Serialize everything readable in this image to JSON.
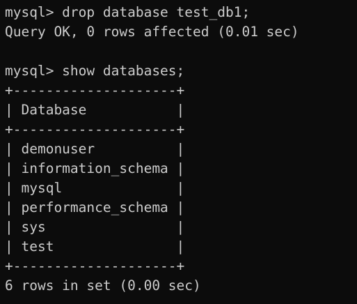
{
  "terminal": {
    "lines": [
      "mysql> drop database test_db1;",
      "Query OK, 0 rows affected (0.01 sec)",
      "",
      "mysql> show databases;",
      "+--------------------+",
      "| Database           |",
      "+--------------------+",
      "| demonuser          |",
      "| information_schema |",
      "| mysql              |",
      "| performance_schema |",
      "| sys                |",
      "| test               |",
      "+--------------------+",
      "6 rows in set (0.00 sec)"
    ]
  },
  "colors": {
    "background": "#0c0c0c",
    "text": "#cccccc"
  }
}
